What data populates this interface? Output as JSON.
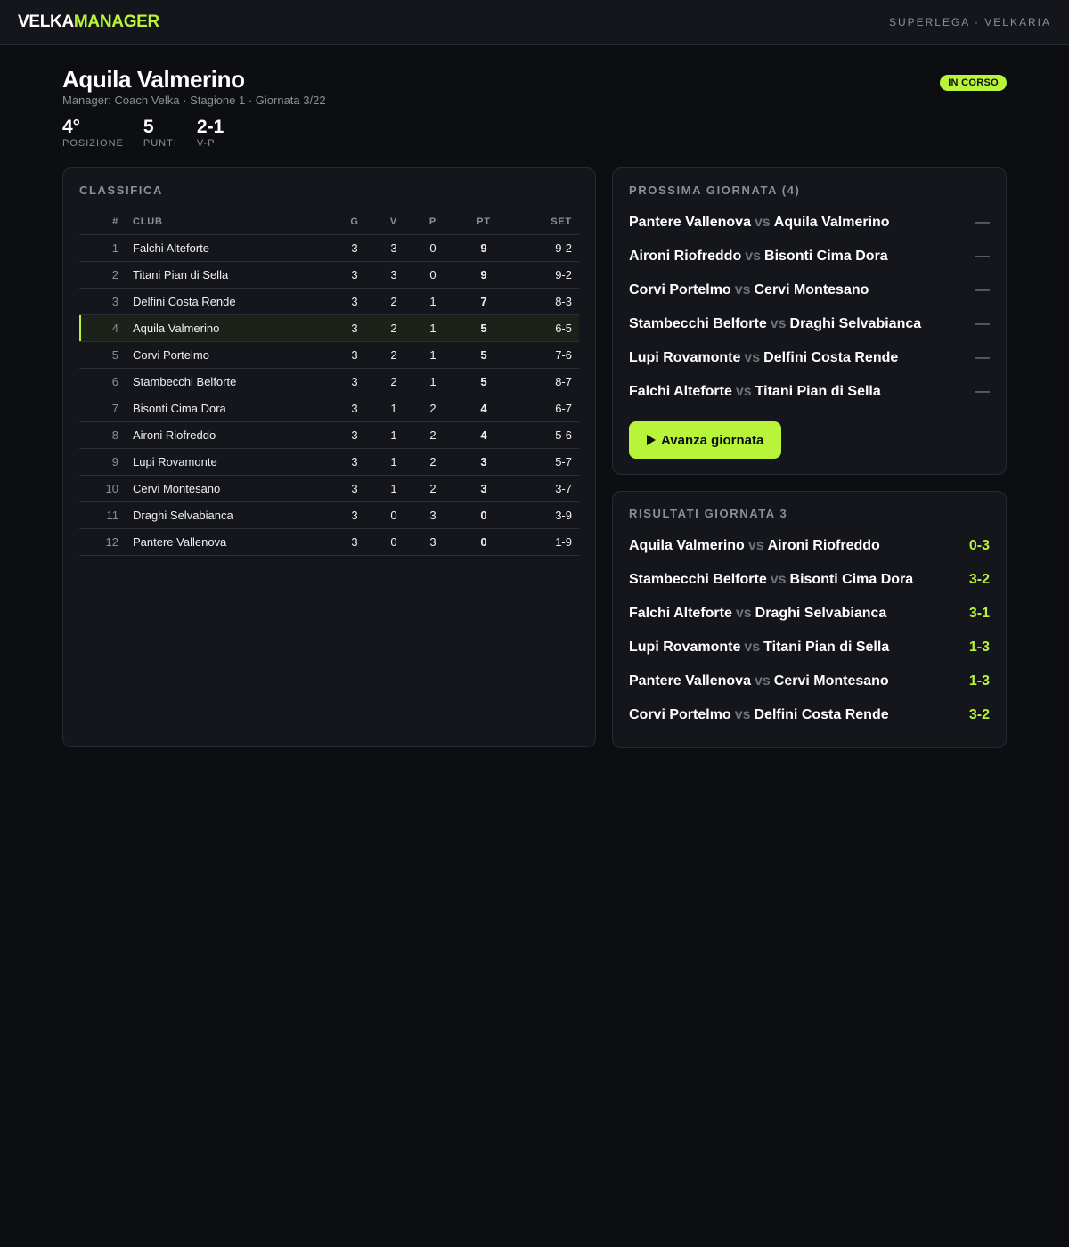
{
  "brand": {
    "part1": "VELKA",
    "part2": "MANAGER",
    "accent": "#b8f53a"
  },
  "league": "SUPERLEGA · VELKARIA",
  "team": {
    "name": "Aquila Valmerino",
    "subtitle": "Manager: Coach Velka · Stagione 1 · Giornata 3/22",
    "status": "IN CORSO"
  },
  "stats": [
    {
      "value": "4°",
      "label": "POSIZIONE"
    },
    {
      "value": "5",
      "label": "PUNTI"
    },
    {
      "value": "2-1",
      "label": "V-P"
    }
  ],
  "standings": {
    "title": "CLASSIFICA",
    "headers": {
      "pos": "#",
      "club": "CLUB",
      "g": "G",
      "v": "V",
      "p": "P",
      "pt": "PT",
      "set": "SET"
    },
    "rows": [
      {
        "pos": "1",
        "club": "Falchi Alteforte",
        "g": "3",
        "v": "3",
        "p": "0",
        "pt": "9",
        "set": "9-2"
      },
      {
        "pos": "2",
        "club": "Titani Pian di Sella",
        "g": "3",
        "v": "3",
        "p": "0",
        "pt": "9",
        "set": "9-2"
      },
      {
        "pos": "3",
        "club": "Delfini Costa Rende",
        "g": "3",
        "v": "2",
        "p": "1",
        "pt": "7",
        "set": "8-3"
      },
      {
        "pos": "4",
        "club": "Aquila Valmerino",
        "g": "3",
        "v": "2",
        "p": "1",
        "pt": "5",
        "set": "6-5",
        "highlight": true
      },
      {
        "pos": "5",
        "club": "Corvi Portelmo",
        "g": "3",
        "v": "2",
        "p": "1",
        "pt": "5",
        "set": "7-6"
      },
      {
        "pos": "6",
        "club": "Stambecchi Belforte",
        "g": "3",
        "v": "2",
        "p": "1",
        "pt": "5",
        "set": "8-7"
      },
      {
        "pos": "7",
        "club": "Bisonti Cima Dora",
        "g": "3",
        "v": "1",
        "p": "2",
        "pt": "4",
        "set": "6-7"
      },
      {
        "pos": "8",
        "club": "Aironi Riofreddo",
        "g": "3",
        "v": "1",
        "p": "2",
        "pt": "4",
        "set": "5-6"
      },
      {
        "pos": "9",
        "club": "Lupi Rovamonte",
        "g": "3",
        "v": "1",
        "p": "2",
        "pt": "3",
        "set": "5-7"
      },
      {
        "pos": "10",
        "club": "Cervi Montesano",
        "g": "3",
        "v": "1",
        "p": "2",
        "pt": "3",
        "set": "3-7"
      },
      {
        "pos": "11",
        "club": "Draghi Selvabianca",
        "g": "3",
        "v": "0",
        "p": "3",
        "pt": "0",
        "set": "3-9"
      },
      {
        "pos": "12",
        "club": "Pantere Vallenova",
        "g": "3",
        "v": "0",
        "p": "3",
        "pt": "0",
        "set": "1-9"
      }
    ]
  },
  "next_round": {
    "title": "PROSSIMA GIORNATA (4)",
    "vs": "vs",
    "matches": [
      {
        "home": "Pantere Vallenova",
        "away": "Aquila Valmerino",
        "score": "—"
      },
      {
        "home": "Aironi Riofreddo",
        "away": "Bisonti Cima Dora",
        "score": "—"
      },
      {
        "home": "Corvi Portelmo",
        "away": "Cervi Montesano",
        "score": "—"
      },
      {
        "home": "Stambecchi Belforte",
        "away": "Draghi Selvabianca",
        "score": "—"
      },
      {
        "home": "Lupi Rovamonte",
        "away": "Delfini Costa Rende",
        "score": "—"
      },
      {
        "home": "Falchi Alteforte",
        "away": "Titani Pian di Sella",
        "score": "—"
      }
    ],
    "button_label": "Avanza giornata",
    "button_icon": "play-icon"
  },
  "results": {
    "title": "RISULTATI GIORNATA 3",
    "vs": "vs",
    "matches": [
      {
        "home": "Aquila Valmerino",
        "away": "Aironi Riofreddo",
        "score": "0-3"
      },
      {
        "home": "Stambecchi Belforte",
        "away": "Bisonti Cima Dora",
        "score": "3-2"
      },
      {
        "home": "Falchi Alteforte",
        "away": "Draghi Selvabianca",
        "score": "3-1"
      },
      {
        "home": "Lupi Rovamonte",
        "away": "Titani Pian di Sella",
        "score": "1-3"
      },
      {
        "home": "Pantere Vallenova",
        "away": "Cervi Montesano",
        "score": "1-3"
      },
      {
        "home": "Corvi Portelmo",
        "away": "Delfini Costa Rende",
        "score": "3-2"
      }
    ]
  }
}
